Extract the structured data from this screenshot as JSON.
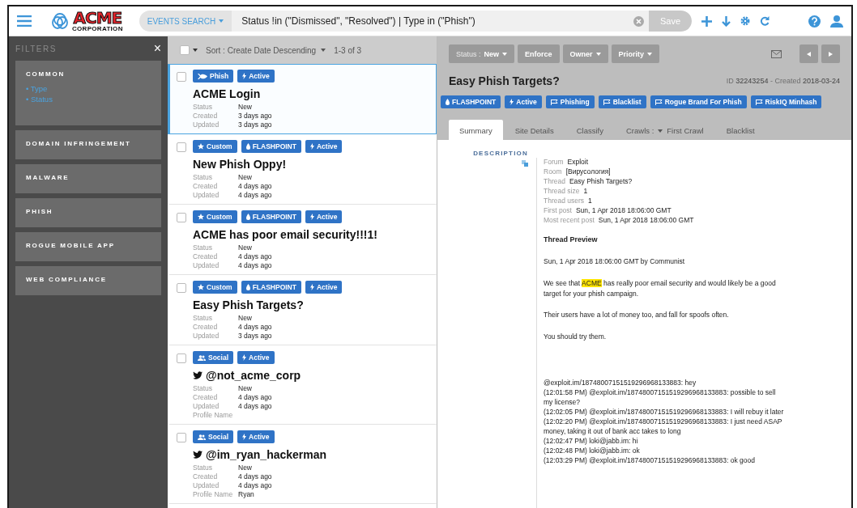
{
  "topbar": {
    "logo": "ACME",
    "logo_sub": "CORPORATION",
    "search_scope": "EVENTS SEARCH",
    "query": "Status !in (\"Dismissed\", \"Resolved\") | Type in (\"Phish\")",
    "save": "Save"
  },
  "filters": {
    "title": "FILTERS",
    "close": "×",
    "groups": [
      {
        "label": "COMMON",
        "expanded": true,
        "children": [
          {
            "label": "• Type"
          },
          {
            "label": "• Status"
          }
        ]
      },
      {
        "label": "DOMAIN INFRINGEMENT",
        "expanded": false
      },
      {
        "label": "MALWARE",
        "expanded": false
      },
      {
        "label": "PHISH",
        "expanded": false
      },
      {
        "label": "ROGUE MOBILE APP",
        "expanded": false
      },
      {
        "label": "WEB COMPLIANCE",
        "expanded": false
      }
    ]
  },
  "list": {
    "select_all_checked": false,
    "sort": "Sort : Create Date Descending",
    "count": "1-3 of 3",
    "events": [
      {
        "kind": "event",
        "selected": true,
        "checked": false,
        "tags": [
          {
            "kind": "phish",
            "label": "Phish"
          },
          {
            "kind": "active",
            "label": "Active"
          }
        ],
        "title": "ACME Login",
        "fields": [
          {
            "label": "Status",
            "value": "New"
          },
          {
            "label": "Created",
            "value": "3 days ago"
          },
          {
            "label": "Updated",
            "value": "3 days ago"
          }
        ]
      },
      {
        "kind": "event",
        "selected": false,
        "checked": false,
        "tags": [
          {
            "kind": "custom",
            "label": "Custom"
          },
          {
            "kind": "flashpoint",
            "label": "FLASHPOINT"
          },
          {
            "kind": "active",
            "label": "Active"
          }
        ],
        "title": "New Phish Oppy!",
        "fields": [
          {
            "label": "Status",
            "value": "New"
          },
          {
            "label": "Created",
            "value": "4 days ago"
          },
          {
            "label": "Updated",
            "value": "4 days ago"
          }
        ]
      },
      {
        "kind": "event",
        "selected": false,
        "checked": false,
        "tags": [
          {
            "kind": "custom",
            "label": "Custom"
          },
          {
            "kind": "flashpoint",
            "label": "FLASHPOINT"
          },
          {
            "kind": "active",
            "label": "Active"
          }
        ],
        "title": "ACME has poor email security!!!1!",
        "fields": [
          {
            "label": "Status",
            "value": "New"
          },
          {
            "label": "Created",
            "value": "4 days ago"
          },
          {
            "label": "Updated",
            "value": "4 days ago"
          }
        ]
      },
      {
        "kind": "event",
        "selected": false,
        "checked": false,
        "tags": [
          {
            "kind": "custom",
            "label": "Custom"
          },
          {
            "kind": "flashpoint",
            "label": "FLASHPOINT"
          },
          {
            "kind": "active",
            "label": "Active"
          }
        ],
        "title": "Easy Phish Targets?",
        "fields": [
          {
            "label": "Status",
            "value": "New"
          },
          {
            "label": "Created",
            "value": "4 days ago"
          },
          {
            "label": "Updated",
            "value": "3 days ago"
          }
        ]
      },
      {
        "kind": "twitter",
        "selected": false,
        "checked": false,
        "tags": [
          {
            "kind": "social",
            "label": "Social"
          },
          {
            "kind": "active",
            "label": "Active"
          }
        ],
        "title": "@not_acme_corp",
        "fields": [
          {
            "label": "Status",
            "value": "New"
          },
          {
            "label": "Created",
            "value": "4 days ago"
          },
          {
            "label": "Updated",
            "value": "4 days ago"
          },
          {
            "label": "Profile Name"
          }
        ]
      },
      {
        "kind": "twitter",
        "selected": false,
        "checked": false,
        "tags": [
          {
            "kind": "social",
            "label": "Social"
          },
          {
            "kind": "active",
            "label": "Active"
          }
        ],
        "title": "@im_ryan_hackerman",
        "fields": [
          {
            "label": "Status",
            "value": "New"
          },
          {
            "label": "Created",
            "value": "4 days ago"
          },
          {
            "label": "Updated",
            "value": "4 days ago"
          },
          {
            "label": "Profile Name",
            "value": "Ryan"
          }
        ]
      }
    ]
  },
  "detail": {
    "actions": [
      {
        "kind": "dropdown",
        "label": "Status :",
        "value": "New"
      },
      {
        "kind": "button",
        "label": "Enforce"
      },
      {
        "kind": "dropdown",
        "label": "Owner"
      },
      {
        "kind": "dropdown",
        "label": "Priority"
      }
    ],
    "title": "Easy Phish Targets?",
    "id_label": "ID",
    "id": "32243254",
    "created_label": "- Created",
    "created": "2018-03-24",
    "tags": [
      {
        "kind": "flashpoint",
        "label": "FLASHPOINT"
      },
      {
        "kind": "active",
        "label": "Active"
      },
      {
        "kind": "flag",
        "label": "Phishing"
      },
      {
        "kind": "flag",
        "label": "Blacklist"
      },
      {
        "kind": "flag",
        "label": "Rogue Brand For Phish"
      },
      {
        "kind": "flag",
        "label": "RiskIQ Minhash"
      }
    ],
    "tabs": [
      {
        "label": "Summary",
        "selected": true
      },
      {
        "label": "Site Details",
        "selected": false
      },
      {
        "label": "Classify",
        "selected": false
      },
      {
        "label": "Crawls :",
        "value": "First Crawl",
        "selected": false
      },
      {
        "label": "Blacklist",
        "selected": false
      }
    ],
    "section": "DESCRIPTION",
    "fields": [
      {
        "label": "Forum",
        "value": "Exploit"
      },
      {
        "label": "Room",
        "value": "[Вирусология]"
      },
      {
        "label": "Thread",
        "value": "Easy Phish Targets?"
      },
      {
        "label": "Thread size",
        "value": "1"
      },
      {
        "label": "Thread users",
        "value": "1"
      },
      {
        "label": "First post",
        "value": "Sun, 1 Apr 2018 18:06:00 GMT"
      },
      {
        "label": "Most recent post",
        "value": "Sun, 1 Apr 2018 18:06:00 GMT"
      }
    ],
    "preview_title": "Thread Preview",
    "preview_meta": "Sun, 1 Apr 2018 18:06:00 GMT by Communist",
    "paragraphs": [
      "We see that **ACME** has really poor email security and would likely be a good target for your phish campaign.",
      "Their users have a lot of money too, and fall for spoofs often.",
      "You should try them."
    ],
    "chat": [
      "@exploit.im/18748007151519296968133883: hey",
      "(12:01:58 PM) @exploit.im/18748007151519296968133883: possible to sell my license?",
      "(12:02:05 PM) @exploit.im/18748007151519296968133883: I will rebuy it later",
      "(12:02:20 PM) @exploit.im/18748007151519296968133883: I just need ASAP money, taking it out of bank acc takes to long",
      "(12:02:47 PM) loki@jabb.im: hi",
      "(12:02:48 PM) loki@jabb.im: ok",
      "(12:03:29 PM) @exploit.im/18748007151519296968133883: ok good"
    ]
  }
}
